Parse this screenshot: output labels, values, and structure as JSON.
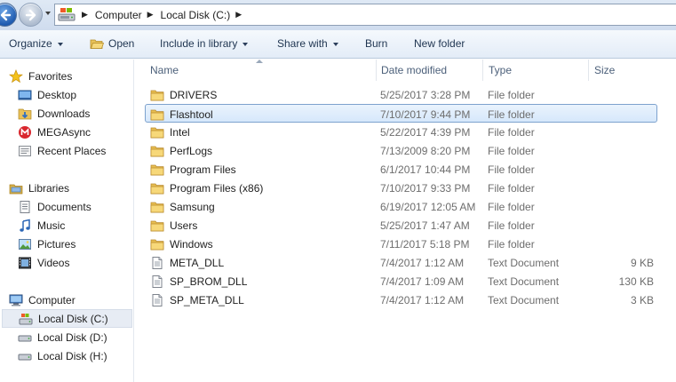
{
  "address_bar": {
    "crumbs": [
      "Computer",
      "Local Disk (C:)"
    ]
  },
  "toolbar": {
    "organize": "Organize",
    "open": "Open",
    "include_in_library": "Include in library",
    "share_with": "Share with",
    "burn": "Burn",
    "new_folder": "New folder"
  },
  "nav": {
    "favorites": {
      "label": "Favorites",
      "items": [
        "Desktop",
        "Downloads",
        "MEGAsync",
        "Recent Places"
      ]
    },
    "libraries": {
      "label": "Libraries",
      "items": [
        "Documents",
        "Music",
        "Pictures",
        "Videos"
      ]
    },
    "computer": {
      "label": "Computer",
      "items": [
        "Local Disk (C:)",
        "Local Disk (D:)",
        "Local Disk (H:)"
      ],
      "selected": "Local Disk (C:)"
    }
  },
  "columns": {
    "name": "Name",
    "date": "Date modified",
    "type": "Type",
    "size": "Size"
  },
  "files": [
    {
      "name": "DRIVERS",
      "date": "5/25/2017 3:28 PM",
      "type": "File folder",
      "size": "",
      "icon": "folder-icon"
    },
    {
      "name": "Flashtool",
      "date": "7/10/2017 9:44 PM",
      "type": "File folder",
      "size": "",
      "icon": "folder-icon",
      "selected": true
    },
    {
      "name": "Intel",
      "date": "5/22/2017 4:39 PM",
      "type": "File folder",
      "size": "",
      "icon": "folder-icon"
    },
    {
      "name": "PerfLogs",
      "date": "7/13/2009 8:20 PM",
      "type": "File folder",
      "size": "",
      "icon": "folder-icon"
    },
    {
      "name": "Program Files",
      "date": "6/1/2017 10:44 PM",
      "type": "File folder",
      "size": "",
      "icon": "folder-icon"
    },
    {
      "name": "Program Files (x86)",
      "date": "7/10/2017 9:33 PM",
      "type": "File folder",
      "size": "",
      "icon": "folder-icon"
    },
    {
      "name": "Samsung",
      "date": "6/19/2017 12:05 AM",
      "type": "File folder",
      "size": "",
      "icon": "folder-icon"
    },
    {
      "name": "Users",
      "date": "5/25/2017 1:47 AM",
      "type": "File folder",
      "size": "",
      "icon": "folder-icon"
    },
    {
      "name": "Windows",
      "date": "7/11/2017 5:18 PM",
      "type": "File folder",
      "size": "",
      "icon": "folder-icon"
    },
    {
      "name": "META_DLL",
      "date": "7/4/2017 1:12 AM",
      "type": "Text Document",
      "size": "9 KB",
      "icon": "text-document-icon"
    },
    {
      "name": "SP_BROM_DLL",
      "date": "7/4/2017 1:09 AM",
      "type": "Text Document",
      "size": "130 KB",
      "icon": "text-document-icon"
    },
    {
      "name": "SP_META_DLL",
      "date": "7/4/2017 1:12 AM",
      "type": "Text Document",
      "size": "3 KB",
      "icon": "text-document-icon"
    }
  ],
  "colors": {
    "selection_fill": "#d6e8fb",
    "selection_border": "#7da2ce",
    "toolbar_text": "#1e3450",
    "secondary_text": "#6d6d6d"
  }
}
